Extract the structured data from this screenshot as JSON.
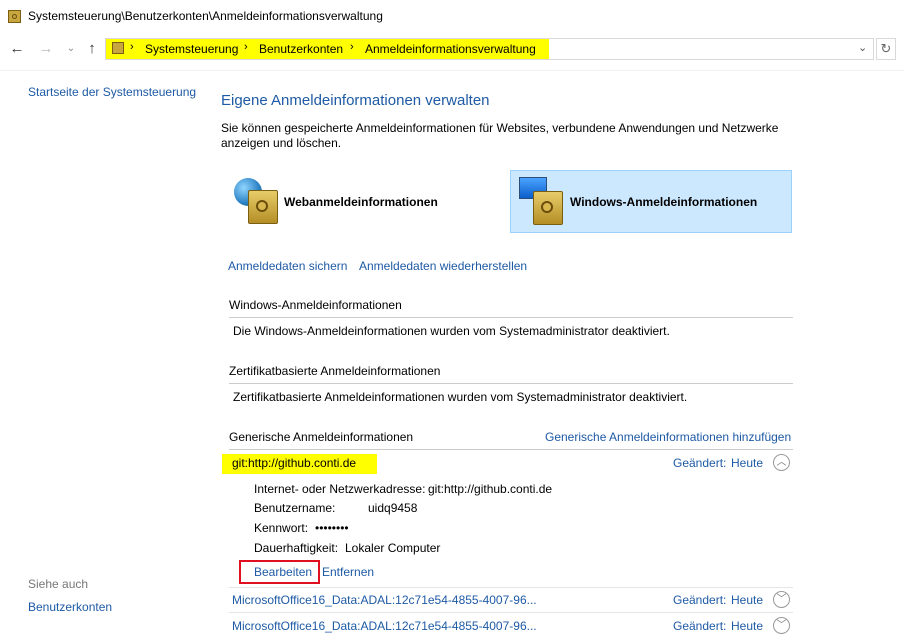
{
  "window": {
    "title": "Systemsteuerung\\Benutzerkonten\\Anmeldeinformationsverwaltung"
  },
  "nav": {
    "back_icon": "arrow-left-icon",
    "forward_icon": "arrow-right-icon",
    "recent_icon": "chevron-down-icon",
    "up_icon": "arrow-up-icon",
    "breadcrumb": [
      "Systemsteuerung",
      "Benutzerkonten",
      "Anmeldeinformationsverwaltung"
    ],
    "separator": "›",
    "dropdown": "⌄",
    "refresh": "↻"
  },
  "sidebar": {
    "home_link": "Startseite der Systemsteuerung",
    "see_also": "Siehe auch",
    "user_accounts": "Benutzerkonten"
  },
  "main": {
    "heading": "Eigene Anmeldeinformationen verwalten",
    "description": "Sie können gespeicherte Anmeldeinformationen für Websites, verbundene Anwendungen und Netzwerke anzeigen und löschen.",
    "tiles": [
      {
        "label": "Webanmeldeinformationen",
        "selected": false
      },
      {
        "label": "Windows-Anmeldeinformationen",
        "selected": true
      }
    ],
    "backup_link": "Anmeldedaten sichern",
    "restore_link": "Anmeldedaten wiederherstellen",
    "windows_section": {
      "title": "Windows-Anmeldeinformationen",
      "body": "Die Windows-Anmeldeinformationen wurden vom Systemadministrator deaktiviert."
    },
    "cert_section": {
      "title": "Zertifikatbasierte Anmeldeinformationen",
      "body": "Zertifikatbasierte Anmeldeinformationen wurden vom Systemadministrator deaktiviert."
    },
    "generic_section": {
      "title": "Generische Anmeldeinformationen",
      "add_link": "Generische Anmeldeinformationen hinzufügen",
      "expanded": {
        "name": "git:http://github.conti.de",
        "changed_label": "Geändert:",
        "changed_value": "Heute",
        "address_label": "Internet- oder Netzwerkadresse:",
        "address_value": "git:http://github.conti.de",
        "user_label": "Benutzername:",
        "user_value": "uidq9458",
        "password_label": "Kennwort:",
        "password_value": "••••••••",
        "persistence_label": "Dauerhaftigkeit:",
        "persistence_value": "Lokaler Computer",
        "edit_link": "Bearbeiten",
        "remove_link": "Entfernen"
      },
      "items": [
        {
          "name": "MicrosoftOffice16_Data:ADAL:12c71e54-4855-4007-96...",
          "changed_label": "Geändert:",
          "changed_value": "Heute"
        },
        {
          "name": "MicrosoftOffice16_Data:ADAL:12c71e54-4855-4007-96...",
          "changed_label": "Geändert:",
          "changed_value": "Heute"
        }
      ]
    }
  },
  "colors": {
    "link": "#1e5aa5",
    "highlight": "#ffff00",
    "selected_tile": "#cce8ff",
    "annotation_box": "#e01020"
  }
}
